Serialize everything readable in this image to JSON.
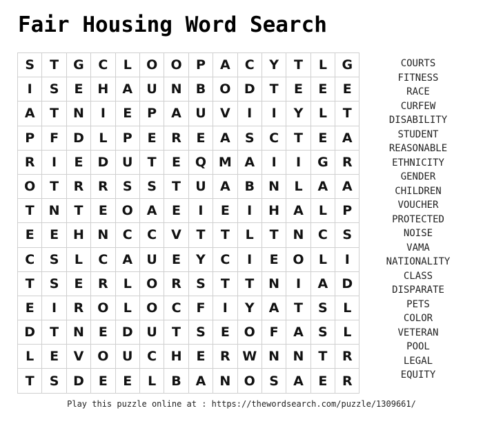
{
  "title": "Fair Housing Word Search",
  "grid": [
    [
      "S",
      "T",
      "G",
      "C",
      "L",
      "O",
      "O",
      "P",
      "A",
      "C",
      "Y",
      "T",
      "L",
      "G"
    ],
    [
      "I",
      "S",
      "E",
      "H",
      "A",
      "U",
      "N",
      "B",
      "O",
      "D",
      "T",
      "E",
      "E",
      "E"
    ],
    [
      "A",
      "T",
      "N",
      "I",
      "E",
      "P",
      "A",
      "U",
      "V",
      "I",
      "I",
      "Y",
      "L",
      "T"
    ],
    [
      "P",
      "F",
      "D",
      "L",
      "P",
      "E",
      "R",
      "E",
      "A",
      "S",
      "C",
      "T",
      "E",
      "A"
    ],
    [
      "R",
      "I",
      "E",
      "D",
      "U",
      "T",
      "E",
      "Q",
      "M",
      "A",
      "I",
      "I",
      "G",
      "R"
    ],
    [
      "O",
      "T",
      "R",
      "R",
      "S",
      "S",
      "T",
      "U",
      "A",
      "B",
      "N",
      "L",
      "A",
      "A"
    ],
    [
      "T",
      "N",
      "T",
      "E",
      "O",
      "A",
      "E",
      "I",
      "E",
      "I",
      "H",
      "A",
      "L",
      "P"
    ],
    [
      "E",
      "E",
      "H",
      "N",
      "C",
      "C",
      "V",
      "T",
      "T",
      "L",
      "T",
      "N",
      "C",
      "S"
    ],
    [
      "C",
      "S",
      "L",
      "C",
      "A",
      "U",
      "E",
      "Y",
      "C",
      "I",
      "E",
      "O",
      "L",
      "I"
    ],
    [
      "T",
      "S",
      "E",
      "R",
      "L",
      "O",
      "R",
      "S",
      "T",
      "T",
      "N",
      "I",
      "A",
      "D"
    ],
    [
      "E",
      "I",
      "R",
      "O",
      "L",
      "O",
      "C",
      "F",
      "I",
      "Y",
      "A",
      "T",
      "S",
      "L"
    ],
    [
      "D",
      "T",
      "N",
      "E",
      "D",
      "U",
      "T",
      "S",
      "E",
      "O",
      "F",
      "A",
      "S",
      "L"
    ],
    [
      "L",
      "E",
      "V",
      "O",
      "U",
      "C",
      "H",
      "E",
      "R",
      "W",
      "N",
      "N",
      "T",
      "R"
    ],
    [
      "T",
      "S",
      "D",
      "E",
      "E",
      "L",
      "B",
      "A",
      "N",
      "O",
      "S",
      "A",
      "E",
      "R"
    ]
  ],
  "words": [
    "COURTS",
    "FITNESS",
    "RACE",
    "CURFEW",
    "DISABILITY",
    "STUDENT",
    "REASONABLE",
    "ETHNICITY",
    "GENDER",
    "CHILDREN",
    "VOUCHER",
    "PROTECTED",
    "NOISE",
    "VAMA",
    "NATIONALITY",
    "CLASS",
    "DISPARATE",
    "PETS",
    "COLOR",
    "VETERAN",
    "POOL",
    "LEGAL",
    "EQUITY"
  ],
  "footer": "Play this puzzle online at : https://thewordsearch.com/puzzle/1309661/"
}
